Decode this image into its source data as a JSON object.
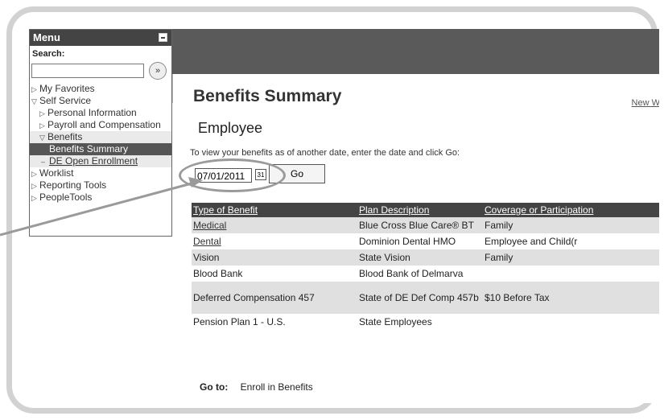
{
  "top": {
    "new_window_link": "New W"
  },
  "menu": {
    "title": "Menu",
    "search_label": "Search:",
    "search_value": "",
    "search_go_glyph": "»",
    "items": [
      {
        "label": "My Favorites"
      },
      {
        "label": "Self Service"
      },
      {
        "label": "Personal Information"
      },
      {
        "label": "Payroll and Compensation"
      },
      {
        "label": "Benefits"
      },
      {
        "label": "Benefits Summary"
      },
      {
        "label": "DE Open Enrollment"
      },
      {
        "label": "Worklist"
      },
      {
        "label": "Reporting Tools"
      },
      {
        "label": "PeopleTools"
      }
    ]
  },
  "page": {
    "title": "Benefits Summary",
    "subtitle": "Employee",
    "instruction": "To view your benefits as of another date, enter the date and click Go:",
    "date_value": "07/01/2011",
    "go_label": "Go"
  },
  "table": {
    "headers": [
      "Type of Benefit",
      "Plan Description",
      "Coverage or Participation"
    ],
    "rows": [
      [
        "Medical",
        "Blue Cross Blue Care® BT",
        "Family"
      ],
      [
        "Dental",
        "Dominion Dental HMO",
        "Employee and Child(r"
      ],
      [
        "Vision",
        "State Vision",
        "Family"
      ],
      [
        "Blood Bank",
        "Blood Bank of Delmarva",
        ""
      ],
      [
        "Deferred Compensation 457",
        "State of DE Def Comp 457b",
        "$10 Before Tax"
      ],
      [
        "Pension Plan 1 - U.S.",
        "State Employees",
        ""
      ]
    ]
  },
  "goto": {
    "label": "Go to:",
    "link": "Enroll in Benefits"
  },
  "colors": {
    "header_bg": "#5a5a5a",
    "table_header_bg": "#444444",
    "frame_border": "#d2d2d2"
  }
}
